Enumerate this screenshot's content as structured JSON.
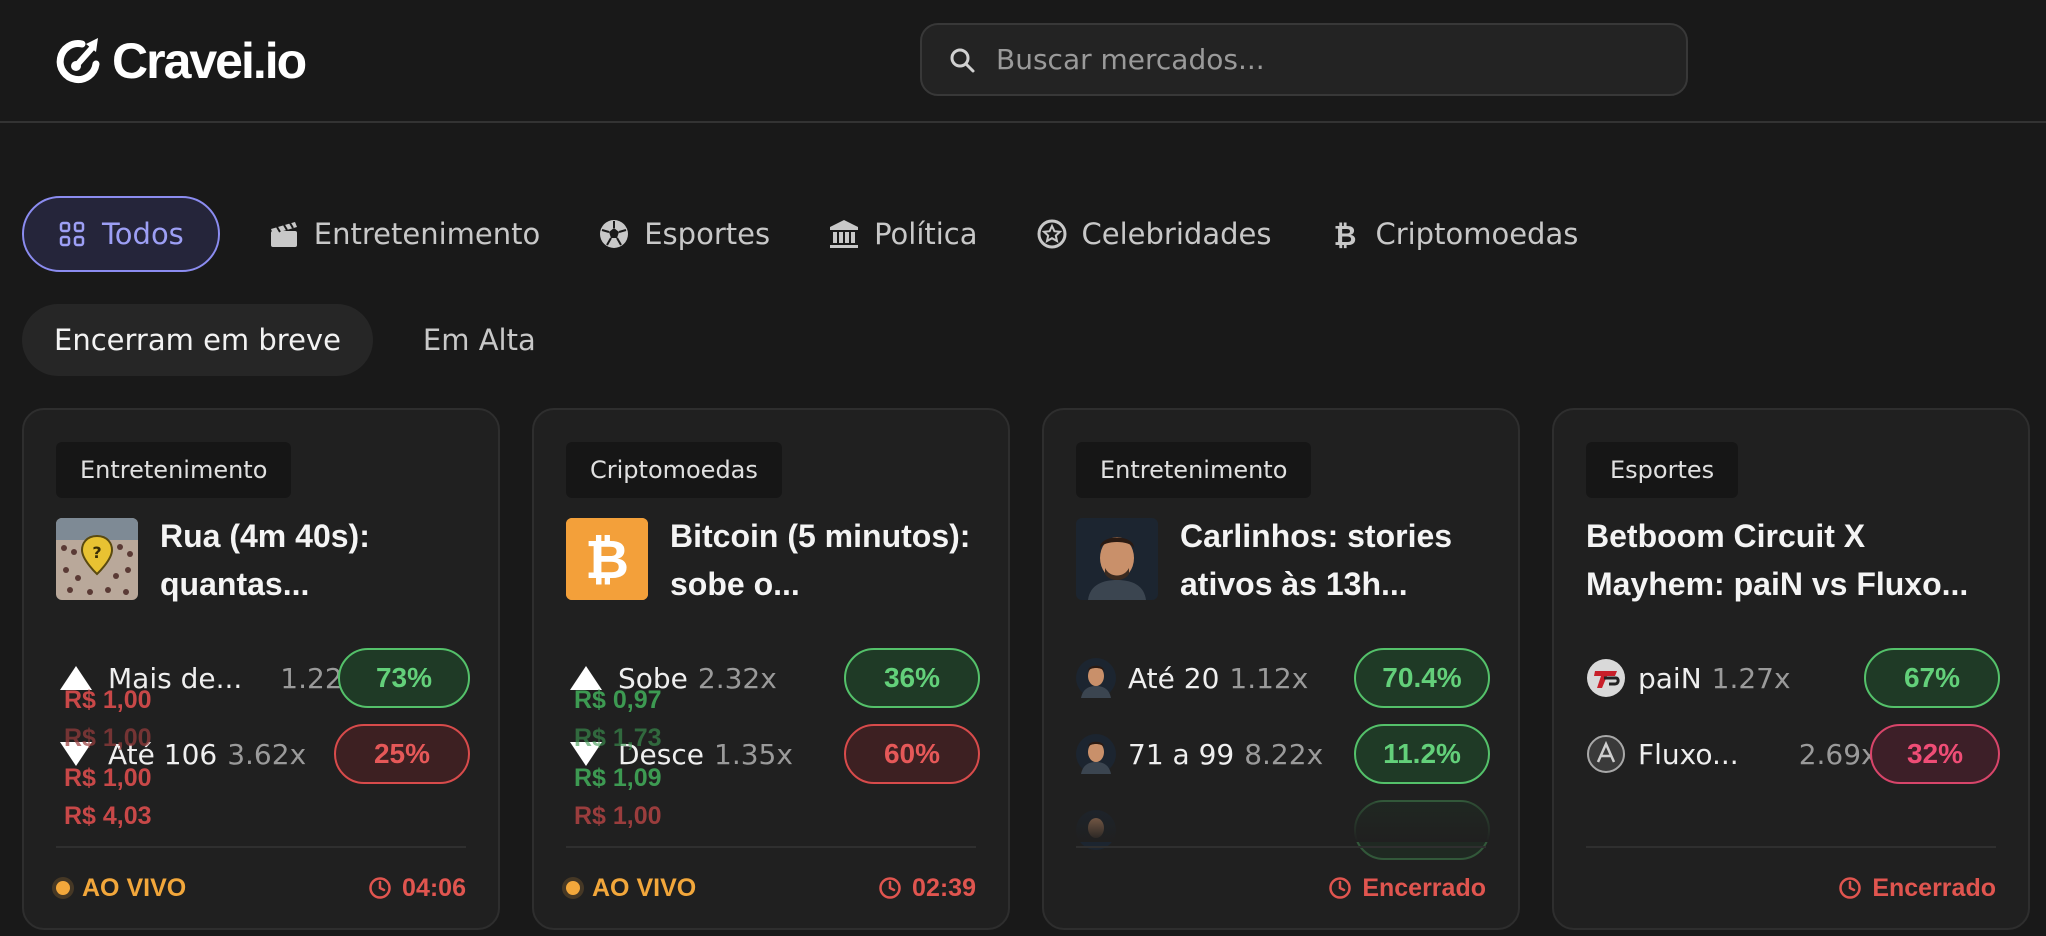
{
  "header": {
    "logo_text": "Cravei.io",
    "search_placeholder": "Buscar mercados..."
  },
  "category_tabs": [
    {
      "label": "Todos",
      "icon": "grid-icon",
      "active": true
    },
    {
      "label": "Entretenimento",
      "icon": "clapperboard-icon"
    },
    {
      "label": "Esportes",
      "icon": "soccer-ball-icon"
    },
    {
      "label": "Política",
      "icon": "government-building-icon"
    },
    {
      "label": "Celebridades",
      "icon": "star-badge-icon"
    },
    {
      "label": "Criptomoedas",
      "icon": "bitcoin-icon"
    }
  ],
  "filter_tabs": [
    {
      "label": "Encerram em breve",
      "active": true
    },
    {
      "label": "Em Alta"
    }
  ],
  "cards": [
    {
      "category": "Entretenimento",
      "title": "Rua (4m 40s): quantas...",
      "outcomes": [
        {
          "label": "Mais de...",
          "multiplier": "1.22x",
          "percent": "73%"
        },
        {
          "label": "Até 106",
          "multiplier": "3.62x",
          "percent": "25%"
        }
      ],
      "amounts": [
        "R$ 1,00",
        "R$ 1,00",
        "R$ 1,00",
        "R$ 4,03"
      ],
      "status": "AO VIVO",
      "timer": "04:06"
    },
    {
      "category": "Criptomoedas",
      "title": "Bitcoin (5 minutos): sobe o...",
      "outcomes": [
        {
          "label": "Sobe",
          "multiplier": "2.32x",
          "percent": "36%"
        },
        {
          "label": "Desce",
          "multiplier": "1.35x",
          "percent": "60%"
        }
      ],
      "amounts": [
        "R$ 0,97",
        "R$ 1,73",
        "R$ 1,09",
        "R$ 1,00"
      ],
      "status": "AO VIVO",
      "timer": "02:39"
    },
    {
      "category": "Entretenimento",
      "title": "Carlinhos: stories ativos às 13h...",
      "outcomes": [
        {
          "label": "Até 20",
          "multiplier": "1.12x",
          "percent": "70.4%"
        },
        {
          "label": "71 a 99",
          "multiplier": "8.22x",
          "percent": "11.2%"
        }
      ],
      "status": "Encerrado"
    },
    {
      "category": "Esportes",
      "title": "Betboom Circuit X Mayhem: paiN vs Fluxo...",
      "outcomes": [
        {
          "label": "paiN",
          "multiplier": "1.27x",
          "percent": "67%"
        },
        {
          "label": "Fluxo...",
          "multiplier": "2.69x",
          "percent": "32%"
        }
      ],
      "status": "Encerrado"
    }
  ],
  "colors": {
    "accent": "#8b8cf0",
    "live": "#f2a73b",
    "positive": "#63d07a",
    "negative": "#e55858",
    "bitcoin": "#f7931a"
  }
}
